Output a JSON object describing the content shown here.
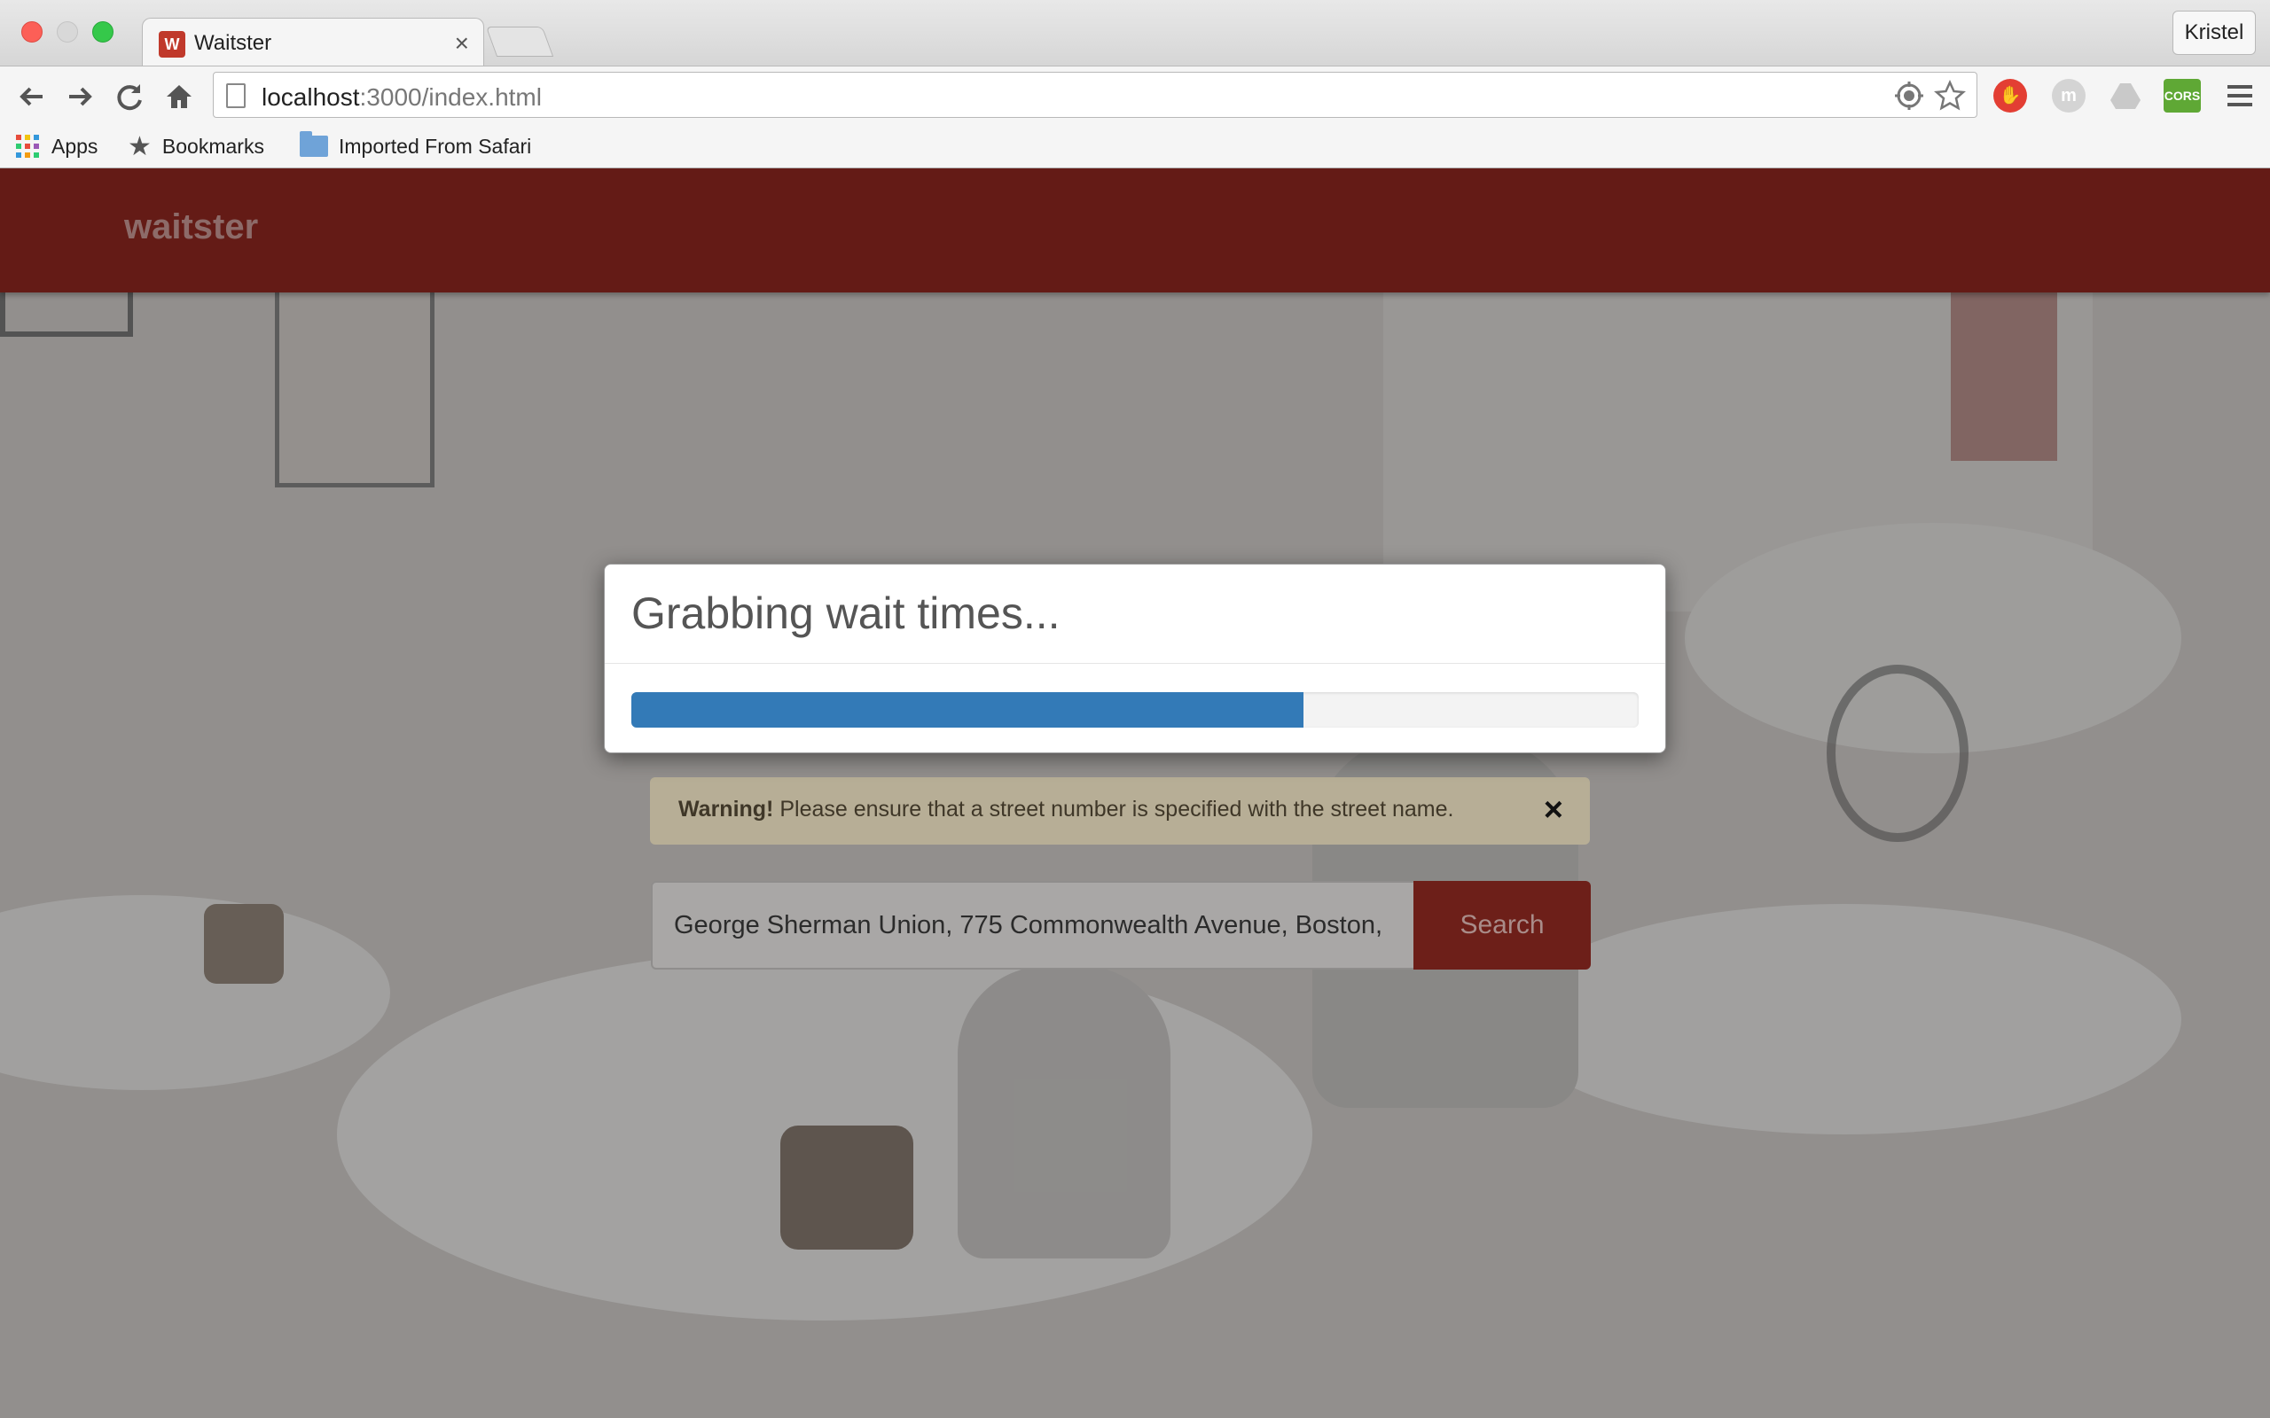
{
  "browser": {
    "tab_title": "Waitster",
    "tab_favicon_letter": "W",
    "profile_name": "Kristel",
    "url_host": "localhost",
    "url_rest": ":3000/index.html",
    "bookmarks": [
      {
        "label": "Apps",
        "icon": "apps-grid-icon"
      },
      {
        "label": "Bookmarks",
        "icon": "star-icon"
      },
      {
        "label": "Imported From Safari",
        "icon": "folder-icon"
      }
    ],
    "extensions": [
      "stop-hand-icon",
      "m-circle-icon",
      "drive-icon",
      "cors-icon"
    ],
    "cors_label": "CORS"
  },
  "app": {
    "brand": "waitster",
    "colors": {
      "navbar": "#641b16",
      "accent_blue": "#337ab7",
      "button": "#6d1f19"
    }
  },
  "modal": {
    "title": "Grabbing wait times...",
    "progress_fraction": 0.667
  },
  "alert": {
    "strong": "Warning!",
    "message": " Please ensure that a street number is specified with the street name.",
    "close": "×"
  },
  "search": {
    "value": "George Sherman Union, 775 Commonwealth Avenue, Boston,",
    "button": "Search"
  }
}
